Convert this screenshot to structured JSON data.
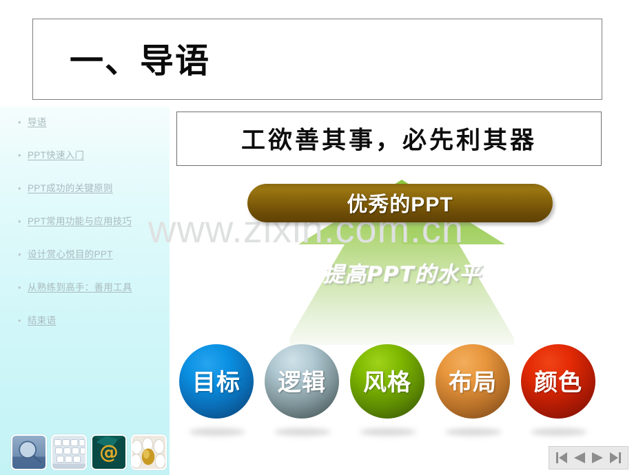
{
  "slide": {
    "title": "一、导语",
    "subtitle": "工欲善其事，必先利其器",
    "watermark": "www.zixin.com.cn"
  },
  "sidebar": {
    "items": [
      {
        "label": "导语"
      },
      {
        "label": "PPT快速入门"
      },
      {
        "label": "PPT成功的关键原则"
      },
      {
        "label": "PPT常用功能与应用技巧"
      },
      {
        "label": "设计赏心悦目的PPT"
      },
      {
        "label": "从熟练到高手：善用工具"
      },
      {
        "label": "结束语"
      }
    ],
    "bullet": "•",
    "thumbnails": [
      {
        "name": "magnifier-thumbnail"
      },
      {
        "name": "keyboard-thumbnail"
      },
      {
        "name": "at-sign-thumbnail"
      },
      {
        "name": "golden-egg-thumbnail"
      }
    ]
  },
  "diagram": {
    "banner_label": "优秀的PPT",
    "arrow_label": "提高PPT的水平",
    "banner_color": "#7f5c08",
    "arrow_color_top": "#8cc63f",
    "arrow_color_bottom": "#f2f7ee",
    "nodes": [
      {
        "label": "目标",
        "color_top": "#0a90e2",
        "color_bottom": "#0a3a68"
      },
      {
        "label": "逻辑",
        "color_top": "#b0c8d2",
        "color_bottom": "#364545"
      },
      {
        "label": "风格",
        "color_top": "#7fb800",
        "color_bottom": "#2f4a04"
      },
      {
        "label": "布局",
        "color_top": "#e8963c",
        "color_bottom": "#6f4018"
      },
      {
        "label": "颜色",
        "color_top": "#e32a05",
        "color_bottom": "#6e1004"
      }
    ]
  },
  "nav": {
    "first_label": "first-slide",
    "prev_label": "previous-slide",
    "next_label": "next-slide",
    "last_label": "last-slide"
  }
}
